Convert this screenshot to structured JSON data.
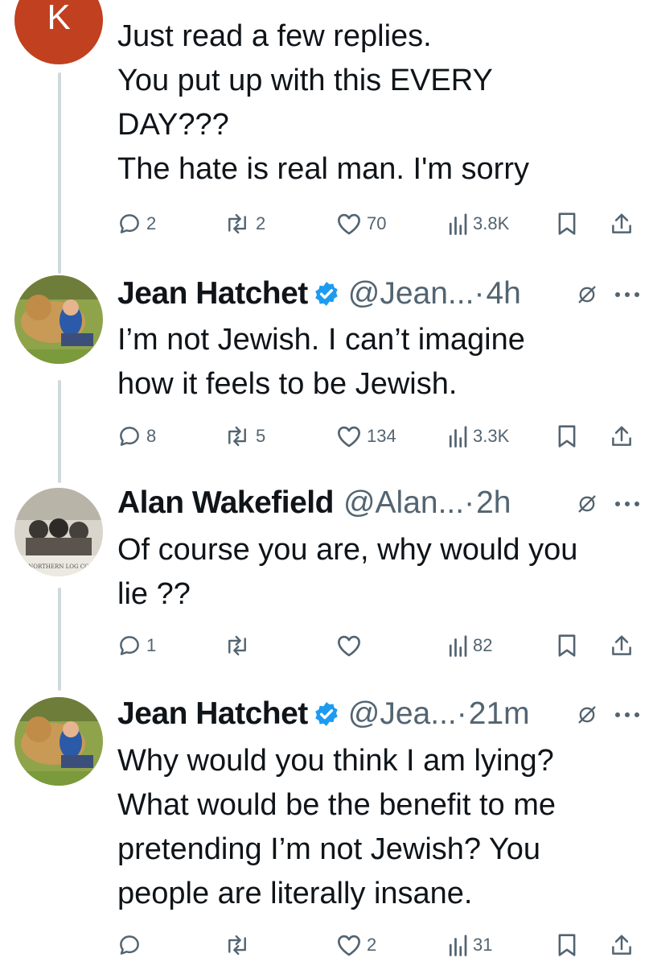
{
  "tweets": [
    {
      "avatar_letter": "K",
      "avatar_color": "#c1401f",
      "lines": [
        "Just read a few replies.",
        "You put up with this EVERY",
        "DAY???",
        "The hate is real man. I'm sorry"
      ],
      "stats": {
        "replies": "2",
        "reposts": "2",
        "likes": "70",
        "views": "3.8K"
      }
    },
    {
      "name": "Jean Hatchet",
      "handle": "@Jean...",
      "dot": "·",
      "time": "4h",
      "verified": true,
      "lines": [
        "I’m not Jewish. I can’t imagine",
        "how it feels to be Jewish."
      ],
      "stats": {
        "replies": "8",
        "reposts": "5",
        "likes": "134",
        "views": "3.3K"
      }
    },
    {
      "name": "Alan Wakefield",
      "handle": "@Alan...",
      "dot": "·",
      "time": "2h",
      "verified": false,
      "avatar_caption": "NORTHERN LOG CO",
      "lines": [
        "Of course you are,  why would you",
        "lie ??"
      ],
      "stats": {
        "replies": "1",
        "reposts": "",
        "likes": "",
        "views": "82"
      }
    },
    {
      "name": "Jean Hatchet",
      "handle": "@Jea...",
      "dot": "·",
      "time": "21m",
      "verified": true,
      "lines": [
        "Why would you think I am lying?",
        "What would be the benefit to me",
        "pretending I’m not Jewish? You",
        "people are literally insane."
      ],
      "stats": {
        "replies": "",
        "reposts": "",
        "likes": "2",
        "views": "31"
      }
    }
  ],
  "colors": {
    "verified": "#1d9bf0",
    "muted": "#536471",
    "thread": "#cfd9de"
  },
  "icons": [
    "reply-icon",
    "repost-icon",
    "like-icon",
    "views-icon",
    "bookmark-icon",
    "share-icon",
    "verified-badge-icon",
    "grok-icon",
    "more-icon"
  ]
}
